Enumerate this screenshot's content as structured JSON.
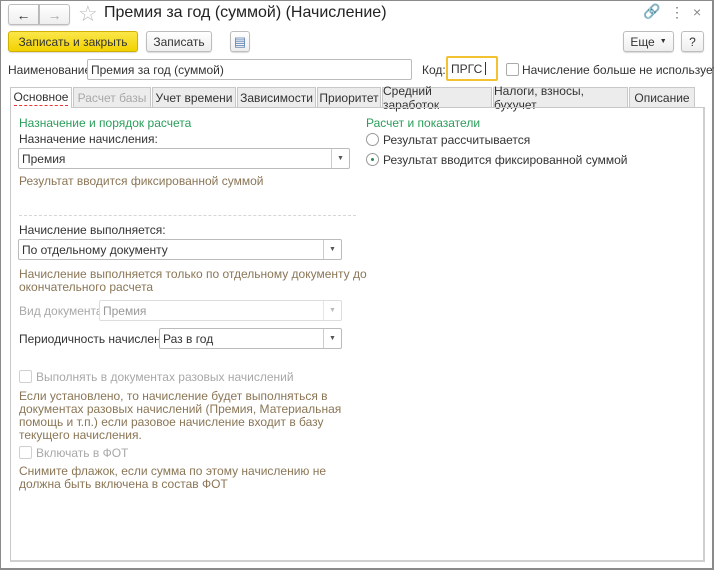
{
  "window": {
    "title": "Премия за год (суммой) (Начисление)"
  },
  "toolbar": {
    "save_close": "Записать и закрыть",
    "save": "Записать",
    "more": "Еще",
    "help": "?"
  },
  "fields": {
    "name_label": "Наименование:",
    "name_value": "Премия за год (суммой)",
    "code_label": "Код:",
    "code_value": "ПРГС",
    "not_used_label": "Начисление больше не используется"
  },
  "tabs": [
    {
      "label": "Основное"
    },
    {
      "label": "Расчет базы"
    },
    {
      "label": "Учет времени"
    },
    {
      "label": "Зависимости"
    },
    {
      "label": "Приоритет"
    },
    {
      "label": "Средний заработок"
    },
    {
      "label": "Налоги, взносы, бухучет"
    },
    {
      "label": "Описание"
    }
  ],
  "left": {
    "heading": "Назначение и порядок расчета",
    "purpose_label": "Назначение начисления:",
    "purpose_value": "Премия",
    "purpose_help": "Результат вводится фиксированной суммой",
    "exec_label": "Начисление выполняется:",
    "exec_value": "По отдельному документу",
    "exec_help1": "Начисление выполняется только по отдельному документу до",
    "exec_help2": "окончательного расчета",
    "doctype_label": "Вид документа:",
    "doctype_value": "Премия",
    "period_label": "Периодичность начисления:",
    "period_value": "Раз в год",
    "onetime_label": "Выполнять в документах разовых начислений",
    "onetime_help": [
      "Если установлено, то начисление будет выполняться в",
      "документах разовых начислений (Премия, Материальная",
      "помощь и т.п.) если разовое начисление входит в базу",
      "текущего начисления."
    ],
    "fot_label": "Включать в ФОТ",
    "fot_help": [
      "Снимите флажок, если сумма по этому начислению не",
      "должна быть включена в состав ФОТ"
    ]
  },
  "right": {
    "heading": "Расчет и показатели",
    "radio1": "Результат рассчитывается",
    "radio2": "Результат вводится фиксированной суммой",
    "selected": 2
  }
}
